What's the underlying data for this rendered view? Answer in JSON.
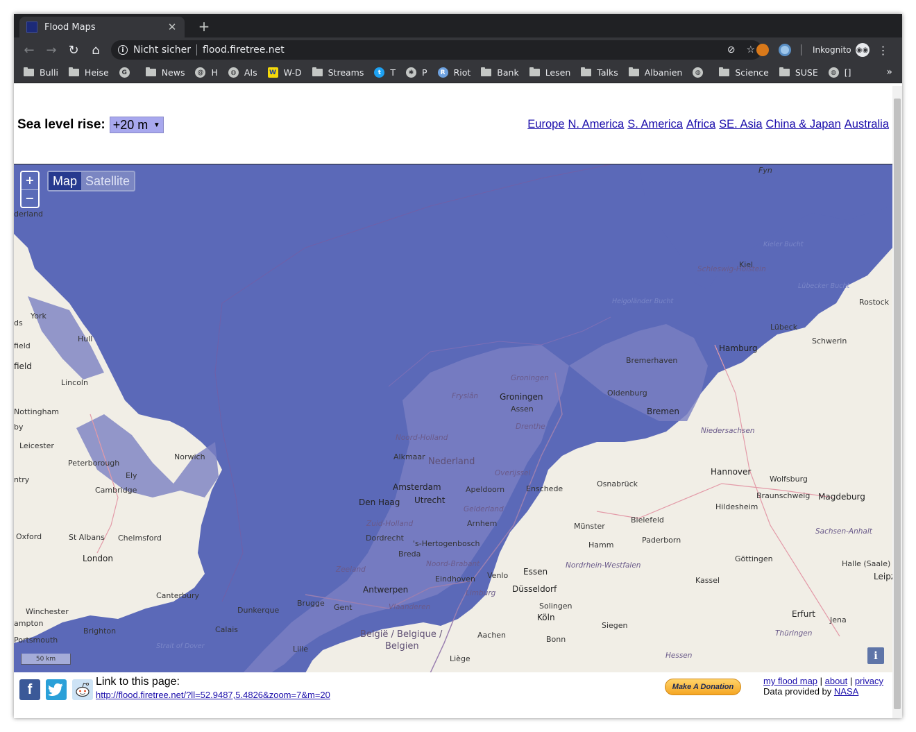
{
  "browser": {
    "tab_title": "Flood Maps",
    "security_label": "Nicht sicher",
    "url": "flood.firetree.net",
    "incognito_label": "Inkognito",
    "bookmarks": [
      {
        "label": "Bulli",
        "icon": "folder-icon"
      },
      {
        "label": "Heise",
        "icon": "folder-icon"
      },
      {
        "label": "",
        "icon": "g-icon"
      },
      {
        "label": "News",
        "icon": "folder-icon"
      },
      {
        "label": "H",
        "icon": "at-icon"
      },
      {
        "label": "AIs",
        "icon": "globe-icon"
      },
      {
        "label": "W-D",
        "icon": "wd-icon"
      },
      {
        "label": "Streams",
        "icon": "folder-icon"
      },
      {
        "label": "T",
        "icon": "twitter-icon"
      },
      {
        "label": "P",
        "icon": "asterisk-icon"
      },
      {
        "label": "Riot",
        "icon": "riot-icon"
      },
      {
        "label": "Bank",
        "icon": "folder-icon"
      },
      {
        "label": "Lesen",
        "icon": "folder-icon"
      },
      {
        "label": "Talks",
        "icon": "folder-icon"
      },
      {
        "label": "Albanien",
        "icon": "folder-icon"
      },
      {
        "label": "",
        "icon": "globe-icon"
      },
      {
        "label": "Science",
        "icon": "folder-icon"
      },
      {
        "label": "SUSE",
        "icon": "folder-icon"
      },
      {
        "label": "[]",
        "icon": "globe-icon"
      }
    ]
  },
  "page": {
    "sea_level_label": "Sea level rise:",
    "sea_level_value": "+20 m",
    "regions": [
      "Europe",
      "N. America",
      "S. America",
      "Africa",
      "SE. Asia",
      "China & Japan",
      "Australia"
    ]
  },
  "map": {
    "zoom_in": "+",
    "zoom_out": "−",
    "type_map": "Map",
    "type_satellite": "Satellite",
    "scale": "50 km",
    "info": "i",
    "flood_color": "#5b69b8",
    "land_color": "#f1eee6",
    "labels": {
      "fyn": "Fyn",
      "kiel": "Kiel",
      "kieler_bucht": "Kieler Bucht",
      "schleswig_holstein": "Schleswig-Holstein",
      "luebecker_bucht": "Lübecker Bucht",
      "rostock": "Rostock",
      "luebeck": "Lübeck",
      "hamburg": "Hamburg",
      "schwerin": "Schwerin",
      "helgolander_bucht": "Helgoländer Bucht",
      "bremerhaven": "Bremerhaven",
      "oldenburg": "Oldenburg",
      "bremen": "Bremen",
      "niedersachsen": "Niedersachsen",
      "hannover": "Hannover",
      "wolfsburg": "Wolfsburg",
      "braunschweig": "Braunschweig",
      "magdeburg": "Magdeburg",
      "hildesheim": "Hildesheim",
      "sachsen_anhalt": "Sachsen-Anhalt",
      "bielefeld": "Bielefeld",
      "osnabrueck": "Osnabrück",
      "paderborn": "Paderborn",
      "muenster": "Münster",
      "hamm": "Hamm",
      "goettingen": "Göttingen",
      "halle": "Halle (Saale)",
      "leipzig": "Leipz",
      "kassel": "Kassel",
      "nrw": "Nordrhein-Westfalen",
      "essen": "Essen",
      "duesseldorf": "Düsseldorf",
      "solingen": "Solingen",
      "koeln": "Köln",
      "siegen": "Siegen",
      "erfurt": "Erfurt",
      "jena": "Jena",
      "thueringen": "Thüringen",
      "bonn": "Bonn",
      "aachen": "Aachen",
      "hessen": "Hessen",
      "groningen_prov": "Groningen",
      "groningen": "Groningen",
      "assen": "Assen",
      "drenthe": "Drenthe",
      "fryslan": "Fryslân",
      "noord_holland": "Noord-Holland",
      "alkmaar": "Alkmaar",
      "nederland": "Nederland",
      "overijssel": "Overijssel",
      "amsterdam": "Amsterdam",
      "den_haag": "Den Haag",
      "utrecht": "Utrecht",
      "apeldoorn": "Apeldoorn",
      "enschede": "Enschede",
      "gelderland": "Gelderland",
      "arnhem": "Arnhem",
      "zuid_holland": "Zuid-Holland",
      "dordrecht": "Dordrecht",
      "hertogenbosch": "'s-Hertogenbosch",
      "breda": "Breda",
      "noord_brabant": "Noord-Brabant",
      "eindhoven": "Eindhoven",
      "venlo": "Venlo",
      "zeeland": "Zeeland",
      "antwerpen": "Antwerpen",
      "limburg": "Limburg",
      "vlaanderen": "Vlaanderen",
      "dunkerque": "Dunkerque",
      "brugge": "Brugge",
      "gent": "Gent",
      "calais": "Calais",
      "lille": "Lille",
      "belgie": "België / Belgique /",
      "belgien": "Belgien",
      "liege": "Liège",
      "york": "York",
      "hull": "Hull",
      "lincoln": "Lincoln",
      "nottingham": "Nottingham",
      "leicester": "Leicester",
      "peterborough": "Peterborough",
      "norwich": "Norwich",
      "ely": "Ely",
      "cambridge": "Cambridge",
      "oxford": "Oxford",
      "st_albans": "St Albans",
      "chelmsford": "Chelmsford",
      "london": "London",
      "canterbury": "Canterbury",
      "winchester": "Winchester",
      "brighton": "Brighton",
      "portsmouth": "Portsmouth",
      "southampton": "ampton",
      "strait_dover": "Strait of Dover",
      "derland": "derland",
      "ds": "ds",
      "field": "field",
      "field2": "field",
      "by": "by",
      "ntry": "ntry"
    }
  },
  "footer": {
    "link_label": "Link to this page:",
    "link_url": "http://flood.firetree.net/?ll=52.9487,5.4826&zoom=7&m=20",
    "donate_label": "Make A Donation",
    "my_flood_map": "my flood map",
    "about": "about",
    "privacy": "privacy",
    "data_prefix": "Data provided by",
    "nasa": "NASA"
  }
}
